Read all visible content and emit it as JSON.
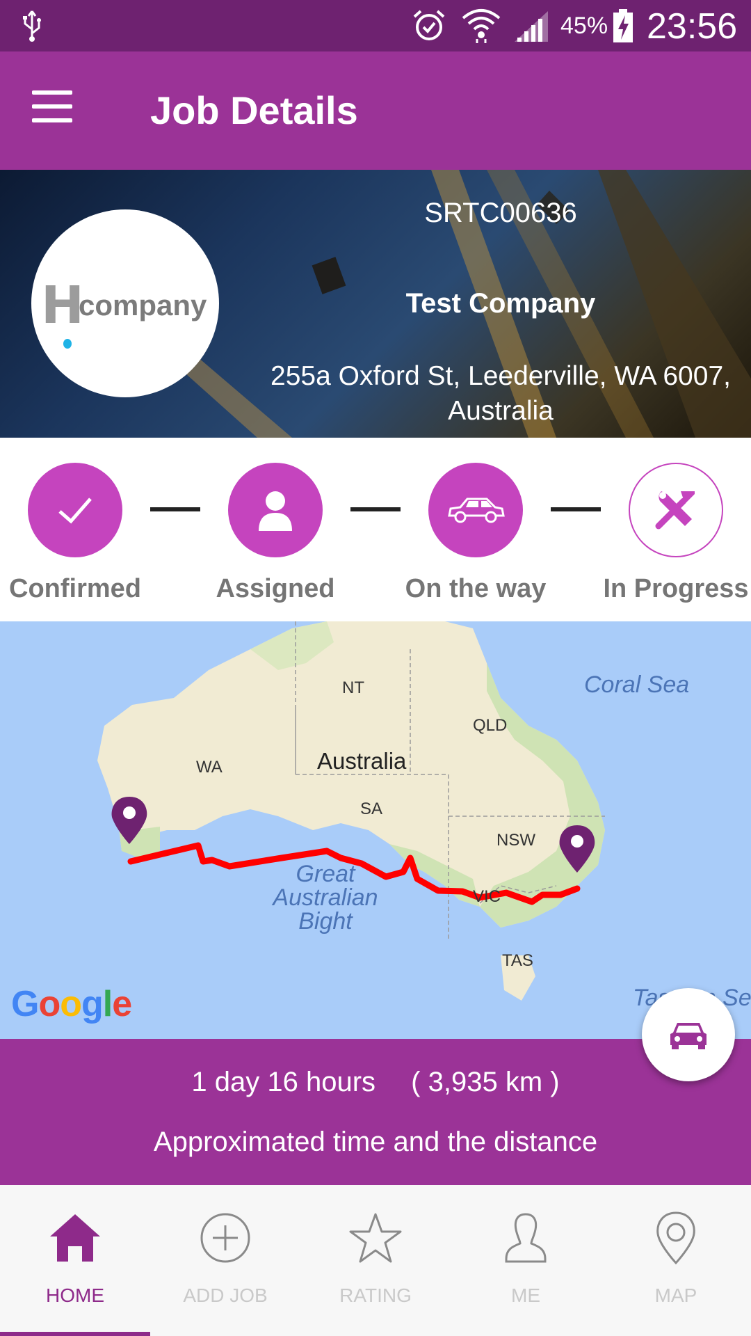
{
  "status_bar": {
    "battery_percent": "45%",
    "time": "23:56",
    "icons": [
      "usb-icon",
      "alarm-icon",
      "wifi-icon",
      "signal-icon",
      "battery-charging-icon"
    ]
  },
  "app_bar": {
    "title": "Job Details",
    "menu_icon": "hamburger-menu-icon"
  },
  "job": {
    "id": "SRTC00636",
    "company": "Test Company",
    "address": "255a Oxford St, Leederville, WA 6007, Australia",
    "logo_text": "company",
    "logo_letter": "H"
  },
  "steps": [
    {
      "label": "Confirmed",
      "icon": "checkmark-icon",
      "state": "done"
    },
    {
      "label": "Assigned",
      "icon": "person-icon",
      "state": "done"
    },
    {
      "label": "On the way",
      "icon": "car-icon",
      "state": "done"
    },
    {
      "label": "In Progress",
      "icon": "tools-icon",
      "state": "pending"
    }
  ],
  "map": {
    "country_label": "Australia",
    "region_labels": {
      "nt": "NT",
      "qld": "QLD",
      "wa": "WA",
      "sa": "SA",
      "nsw": "NSW",
      "vic": "VIC",
      "tas": "TAS"
    },
    "sea_labels": {
      "coral": "Coral Sea",
      "bight": "Great Australian Bight",
      "tasman": "Tasman Sea"
    },
    "attribution": "Google",
    "route_color": "#ff0000",
    "marker_color": "#6e2270"
  },
  "eta": {
    "duration": "1 day 16 hours",
    "distance": "( 3,935 km )",
    "caption": "Approximated time and the distance"
  },
  "bottom_nav": {
    "items": [
      {
        "label": "HOME",
        "icon": "home-icon",
        "active": true
      },
      {
        "label": "ADD JOB",
        "icon": "add-circle-icon",
        "active": false
      },
      {
        "label": "RATING",
        "icon": "star-icon",
        "active": false
      },
      {
        "label": "ME",
        "icon": "profile-icon",
        "active": false
      },
      {
        "label": "MAP",
        "icon": "map-pin-icon",
        "active": false
      }
    ]
  },
  "colors": {
    "primary": "#9b3397",
    "primary_dark": "#6e2270",
    "accent": "#c544be",
    "inactive_nav": "#c9c9c9"
  }
}
